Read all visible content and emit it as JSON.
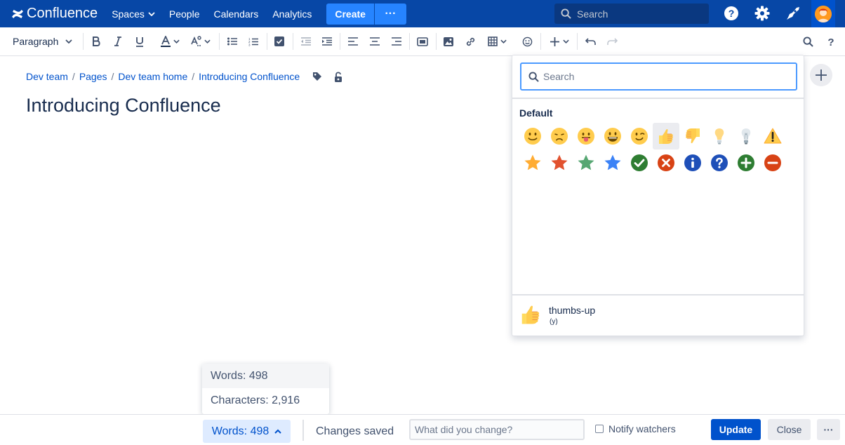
{
  "topnav": {
    "logo": "Confluence",
    "items": [
      "Spaces",
      "People",
      "Calendars",
      "Analytics"
    ],
    "create_label": "Create",
    "more_label": "···",
    "search_placeholder": "Search",
    "colors": {
      "bar": "#0747a6",
      "create": "#2684ff"
    }
  },
  "toolbar": {
    "paragraph_label": "Paragraph"
  },
  "breadcrumb": [
    "Dev team",
    "Pages",
    "Dev team home",
    "Introducing Confluence"
  ],
  "page": {
    "title": "Introducing Confluence"
  },
  "emoji_picker": {
    "search_placeholder": "Search",
    "category": "Default",
    "emojis": [
      "smile",
      "disappointed",
      "tongue-out",
      "grin",
      "wink",
      "thumbs-up",
      "thumbs-down",
      "light-on",
      "light-off",
      "warning",
      "yellow-star",
      "red-star",
      "green-star",
      "blue-star",
      "check-mark",
      "cross-mark",
      "info",
      "question",
      "plus",
      "minus"
    ],
    "selected": "thumbs-up",
    "preview": {
      "name": "thumbs-up",
      "shortcut": "(y)"
    }
  },
  "word_count": {
    "words": "Words: 498",
    "characters": "Characters: 2,916",
    "button_label": "Words: 498"
  },
  "bottom": {
    "status": "Changes saved",
    "change_placeholder": "What did you change?",
    "notify_label": "Notify watchers",
    "update_label": "Update",
    "close_label": "Close",
    "more_label": "···"
  }
}
